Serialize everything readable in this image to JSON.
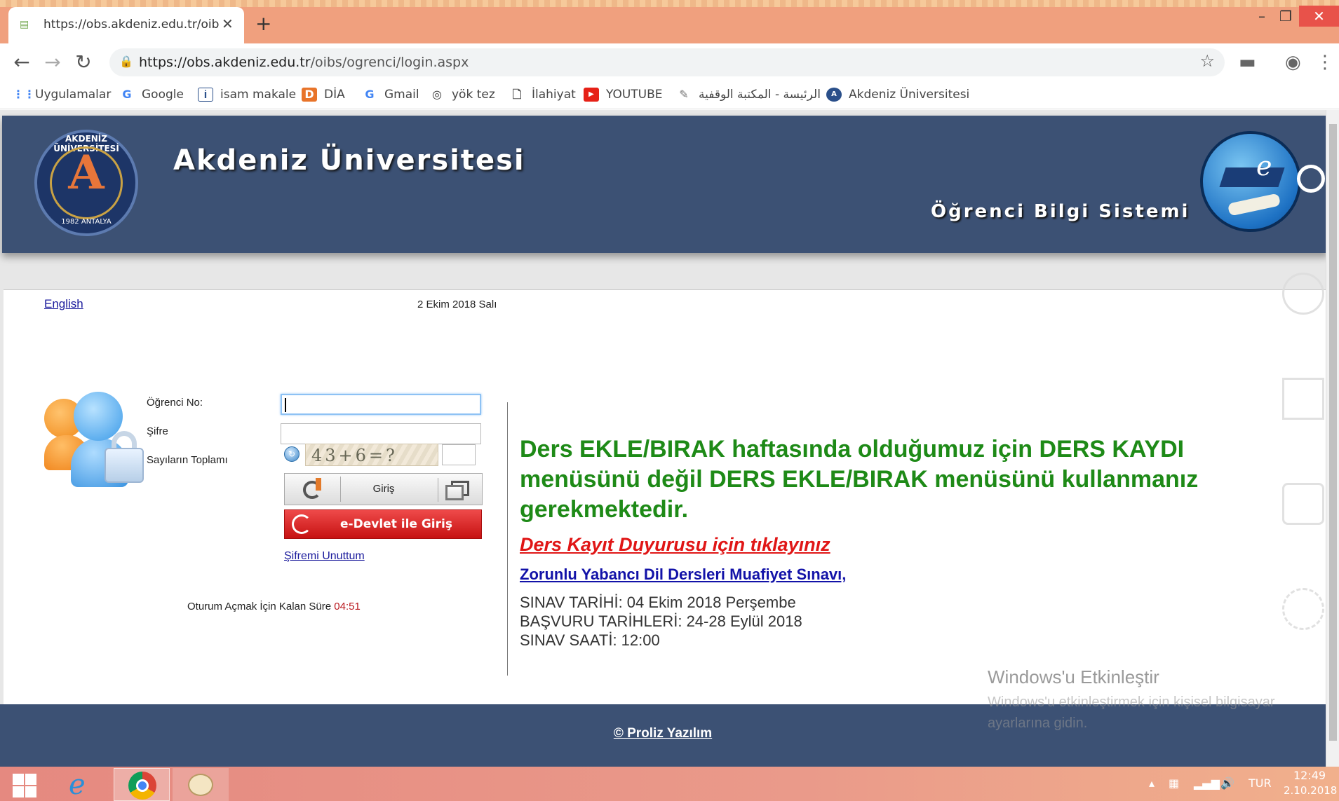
{
  "browser": {
    "tab_title": "https://obs.akdeniz.edu.tr/oibs/o",
    "url_prefix": "https://obs.akdeniz.edu.tr",
    "url_path": "/oibs/ogrenci/login.aspx",
    "new_tab_label": "+",
    "bookmarks": [
      {
        "label": "Uygulamalar",
        "icon": "apps-grid-icon"
      },
      {
        "label": "Google",
        "icon": "google-icon"
      },
      {
        "label": "isam makale",
        "icon": "isam-icon"
      },
      {
        "label": "DİA",
        "icon": "dia-icon"
      },
      {
        "label": "Gmail",
        "icon": "google-icon"
      },
      {
        "label": "yök tez",
        "icon": "yok-icon"
      },
      {
        "label": "İlahiyat",
        "icon": "page-icon"
      },
      {
        "label": "YOUTUBE",
        "icon": "youtube-icon"
      },
      {
        "label": "الرئيسة - المكتبة الوقفية",
        "icon": "book-icon"
      },
      {
        "label": "Akdeniz Üniversitesi",
        "icon": "akdeniz-icon"
      }
    ]
  },
  "header": {
    "university_name": "Akdeniz Üniversitesi",
    "system_name": "Öğrenci Bilgi Sistemi",
    "logo_ring_text": "AKDENİZ ÜNİVERSİTESİ",
    "logo_year": "1982",
    "logo_city": "ANTALYA",
    "e_logo_letter": "e"
  },
  "top": {
    "language_link": "English",
    "date": "2 Ekim 2018 Salı"
  },
  "login": {
    "student_no_label": "Öğrenci No:",
    "student_no_value": "",
    "password_label": "Şifre",
    "password_value": "",
    "captcha_label": "Sayıların Toplamı",
    "captcha_text": "43+6=?",
    "captcha_value": "",
    "login_button": "Giriş",
    "edevlet_button": "e-Devlet ile Giriş",
    "forgot_password": "Şifremi Unuttum",
    "session_label": "Oturum Açmak İçin Kalan Süre",
    "session_time": "04:51"
  },
  "announcement": {
    "title": "Ders EKLE/BIRAK haftasında olduğumuz için DERS KAYDI menüsünü değil DERS EKLE/BIRAK menüsünü kullanmanız gerekmektedir.",
    "link1": "Ders Kayıt Duyurusu için tıklayınız",
    "link2": "Zorunlu Yabancı Dil Dersleri Muafiyet Sınavı,",
    "line1": "SINAV TARİHİ: 04 Ekim 2018 Perşembe",
    "line2": "BAŞVURU TARİHLERİ: 24-28 Eylül 2018",
    "line3": "SINAV SAATİ: 12:00"
  },
  "watermark": {
    "title": "Windows'u Etkinleştir",
    "subtitle": "Windows'u etkinleştirmek için kişisel bilgisayar ayarlarına gidin."
  },
  "footer": {
    "copyright": "© Proliz Yazılım"
  },
  "taskbar": {
    "lang": "TUR",
    "time": "12:49",
    "date": "2.10.2018"
  },
  "colors": {
    "header_bg": "#3c5174",
    "announcement_green": "#1e8a17",
    "link_red": "#e01616",
    "link_blue": "#1212a8"
  }
}
